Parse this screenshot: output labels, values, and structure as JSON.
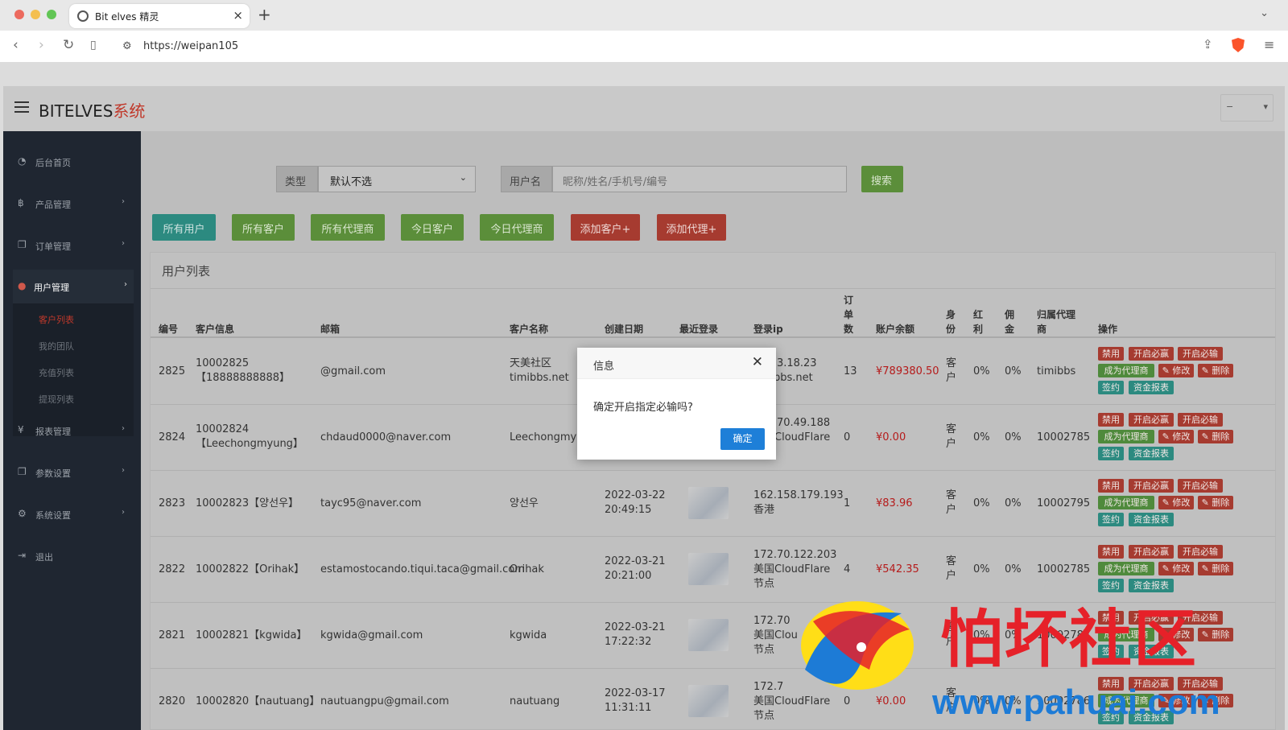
{
  "browser": {
    "tab_title": "Bit elves 精灵",
    "url": "https://weipan105"
  },
  "app": {
    "logo_main": "BITELVES",
    "logo_accent": "系统",
    "header_dropdown": "−"
  },
  "sidebar": {
    "items": [
      {
        "label": "后台首页",
        "icon": "dashboard-icon"
      },
      {
        "label": "产品管理",
        "icon": "bitcoin-icon"
      },
      {
        "label": "订单管理",
        "icon": "copy-icon"
      },
      {
        "label": "用户管理",
        "icon": "user-icon"
      },
      {
        "label": "报表管理",
        "icon": "yen-icon"
      },
      {
        "label": "参数设置",
        "icon": "copy-icon"
      },
      {
        "label": "系统设置",
        "icon": "gears-icon"
      },
      {
        "label": "退出",
        "icon": "sign-out-icon"
      }
    ],
    "sub_items": [
      "客户列表",
      "我的团队",
      "充值列表",
      "提现列表"
    ]
  },
  "filters": {
    "type_label": "类型",
    "type_value": "默认不选",
    "user_label": "用户名",
    "user_placeholder": "昵称/姓名/手机号/编号",
    "search_label": "搜索"
  },
  "filter_buttons": [
    "所有用户",
    "所有客户",
    "所有代理商",
    "今日客户",
    "今日代理商",
    "添加客户+",
    "添加代理+"
  ],
  "panel": {
    "title": "用户列表"
  },
  "columns": [
    "编号",
    "客户信息",
    "邮箱",
    "客户名称",
    "创建日期",
    "最近登录",
    "登录ip",
    "订单数",
    "账户余额",
    "身份",
    "红利",
    "佣金",
    "归属代理商",
    "操作"
  ],
  "action_labels": [
    "禁用",
    "开启必赢",
    "开启必输",
    "成为代理商",
    "修改",
    "删除",
    "签约",
    "资金报表"
  ],
  "rows": [
    {
      "id": "2825",
      "info1": "10002825",
      "info2": "【18888888888】",
      "email": "@gmail.com",
      "name1": "天美社区",
      "name2": "timibbs.net",
      "date1": "",
      "date2": "",
      "ip1": "53.53.18.23",
      "ip2": "timibbs.net",
      "ip3": "",
      "orders": "13",
      "balance": "¥789380.50",
      "role": "客户",
      "bonus": "0%",
      "commission": "0%",
      "agent": "timibbs"
    },
    {
      "id": "2824",
      "info1": "10002824",
      "info2": "【Leechongmyung】",
      "email": "chdaud0000@naver.com",
      "name1": "Leechongmy",
      "name2": "",
      "date1": "",
      "date2": "",
      "ip1": "172.70.49.188",
      "ip2": "美国CloudFlare",
      "ip3": "节点",
      "orders": "0",
      "balance": "¥0.00",
      "role": "客户",
      "bonus": "0%",
      "commission": "0%",
      "agent": "10002785"
    },
    {
      "id": "2823",
      "info1": "10002823【양선우】",
      "info2": "",
      "email": "tayc95@naver.com",
      "name1": "양선우",
      "name2": "",
      "date1": "2022-03-22",
      "date2": "20:49:15",
      "ip1": "162.158.179.193",
      "ip2": "香港",
      "ip3": "",
      "orders": "1",
      "balance": "¥83.96",
      "role": "客户",
      "bonus": "0%",
      "commission": "0%",
      "agent": "10002795"
    },
    {
      "id": "2822",
      "info1": "10002822【Orihak】",
      "info2": "",
      "email": "estamostocando.tiqui.taca@gmail.com",
      "name1": "Orihak",
      "name2": "",
      "date1": "2022-03-21",
      "date2": "20:21:00",
      "ip1": "172.70.122.203",
      "ip2": "美国CloudFlare",
      "ip3": "节点",
      "orders": "4",
      "balance": "¥542.35",
      "role": "客户",
      "bonus": "0%",
      "commission": "0%",
      "agent": "10002785"
    },
    {
      "id": "2821",
      "info1": "10002821【kgwida】",
      "info2": "",
      "email": "kgwida@gmail.com",
      "name1": "kgwida",
      "name2": "",
      "date1": "2022-03-21",
      "date2": "17:22:32",
      "ip1": "172.70",
      "ip2": "美国Clou",
      "ip3": "节点",
      "orders": "0",
      "balance": "¥0.00",
      "role": "客户",
      "bonus": "0%",
      "commission": "0%",
      "agent": "10002782"
    },
    {
      "id": "2820",
      "info1": "10002820【nautuang】",
      "info2": "",
      "email": "nautuangpu@gmail.com",
      "name1": "nautuang",
      "name2": "",
      "date1": "2022-03-17",
      "date2": "11:31:11",
      "ip1": "172.7",
      "ip2": "美国CloudFlare",
      "ip3": "节点",
      "orders": "0",
      "balance": "¥0.00",
      "role": "客户",
      "bonus": "0%",
      "commission": "0%",
      "agent": "10002786"
    }
  ],
  "modal": {
    "title": "信息",
    "message": "确定开启指定必输吗?",
    "ok_label": "确定"
  },
  "watermark": {
    "text": "怕坏社区",
    "url": "www.pahuai.com"
  }
}
